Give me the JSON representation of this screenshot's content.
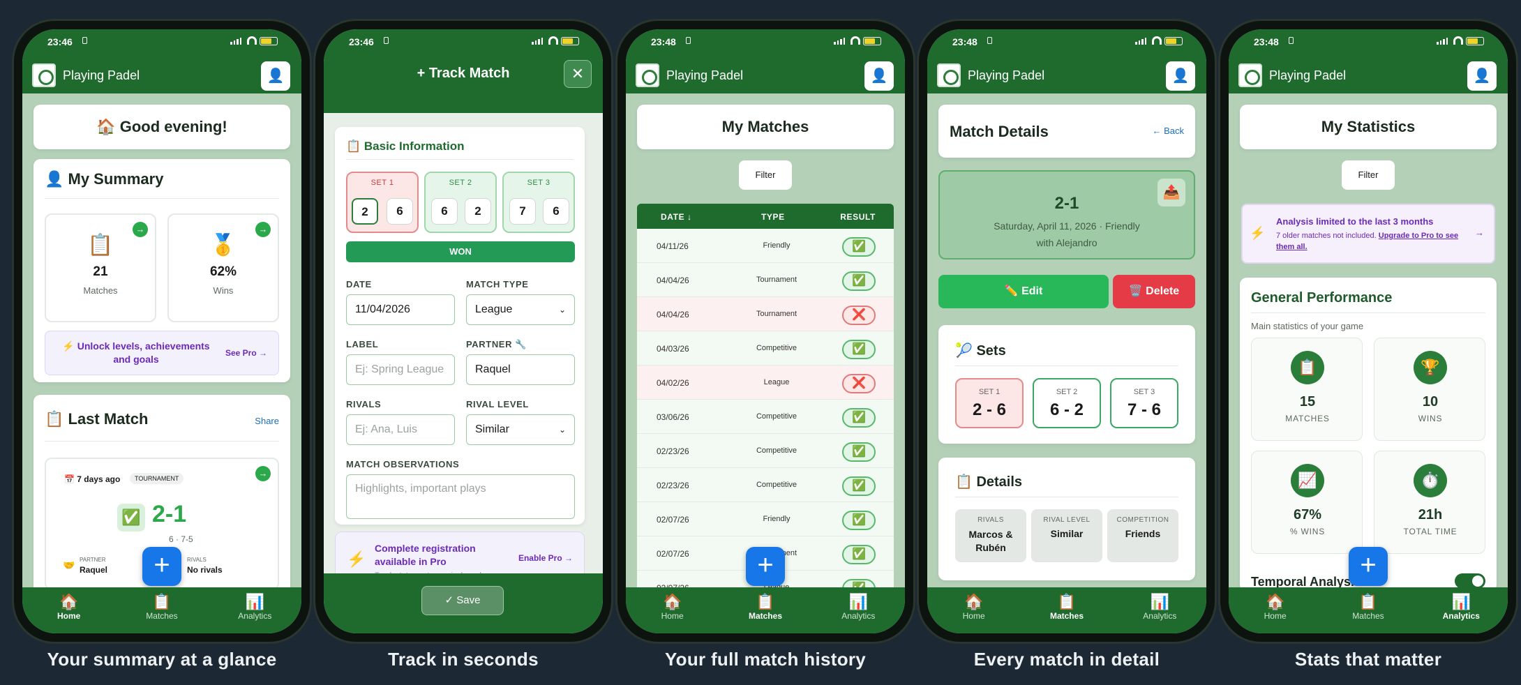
{
  "screens": [
    {
      "time": "23:46",
      "app": "Playing Padel",
      "caption": "Your summary at a glance",
      "greeting": "🏠 Good evening!",
      "summary": {
        "title": "👤 My Summary",
        "matches_value": "21",
        "matches_label": "Matches",
        "wins_value": "62%",
        "wins_label": "Wins",
        "promo": "⚡ Unlock levels, achievements and goals",
        "promo_cta": "See Pro →"
      },
      "last_match": {
        "title": "📋 Last Match",
        "share": "Share",
        "when": "📅 7 days ago",
        "type": "TOURNAMENT",
        "result_icon": "✅",
        "score": "2-1",
        "sets": "6 · 7-5",
        "partner_label": "PARTNER",
        "partner": "Raquel",
        "rivals_label": "RIVALS",
        "rivals": "No rivals"
      }
    },
    {
      "time": "23:46",
      "caption": "Track in seconds",
      "title": "+ Track Match",
      "section": "📋 Basic Information",
      "sets": [
        {
          "label": "SET 1",
          "a": "2",
          "b": "6"
        },
        {
          "label": "SET 2",
          "a": "6",
          "b": "2"
        },
        {
          "label": "SET 3",
          "a": "7",
          "b": "6"
        }
      ],
      "won": "WON",
      "date_label": "DATE",
      "date": "11/04/2026",
      "type_label": "MATCH TYPE",
      "type": "League",
      "label_label": "LABEL",
      "label_ph": "Ej: Spring League",
      "partner_label": "PARTNER 🔧",
      "partner": "Raquel",
      "rivals_label": "RIVALS",
      "rivals_ph": "Ej: Ana, Luis",
      "level_label": "RIVAL LEVEL",
      "level": "Similar",
      "obs_label": "MATCH OBSERVATIONS",
      "obs_ph": "Highlights, important plays",
      "promo": "Complete registration available in Pro",
      "promo_cta": "Enable Pro →",
      "promo_sub": "Track stats, partners, rivals and",
      "save": "✓ Save"
    },
    {
      "time": "23:48",
      "app": "Playing Padel",
      "caption": "Your full match history",
      "title": "My Matches",
      "filter": "Filter",
      "headers": [
        "DATE ↓",
        "TYPE",
        "RESULT"
      ],
      "rows": [
        {
          "date": "04/11/26",
          "type": "Friendly",
          "result": "✅",
          "loss": false
        },
        {
          "date": "04/04/26",
          "type": "Tournament",
          "result": "✅",
          "loss": false
        },
        {
          "date": "04/04/26",
          "type": "Tournament",
          "result": "❌",
          "loss": true
        },
        {
          "date": "04/03/26",
          "type": "Competitive",
          "result": "✅",
          "loss": false
        },
        {
          "date": "04/02/26",
          "type": "League",
          "result": "❌",
          "loss": true
        },
        {
          "date": "03/06/26",
          "type": "Competitive",
          "result": "✅",
          "loss": false
        },
        {
          "date": "02/23/26",
          "type": "Competitive",
          "result": "✅",
          "loss": false
        },
        {
          "date": "02/23/26",
          "type": "Competitive",
          "result": "✅",
          "loss": false
        },
        {
          "date": "02/07/26",
          "type": "Friendly",
          "result": "✅",
          "loss": false
        },
        {
          "date": "02/07/26",
          "type": "Tournament",
          "result": "✅",
          "loss": false
        },
        {
          "date": "02/07/26",
          "type": "League",
          "result": "✅",
          "loss": false
        }
      ]
    },
    {
      "time": "23:48",
      "app": "Playing Padel",
      "caption": "Every match in detail",
      "title": "Match Details",
      "back": "← Back",
      "score": "2-1",
      "date": "Saturday, April 11, 2026 · Friendly",
      "with": "with Alejandro",
      "edit": "✏️ Edit",
      "delete": "🗑️ Delete",
      "sets_title": "🎾 Sets",
      "sets": [
        {
          "label": "SET 1",
          "score": "2 - 6"
        },
        {
          "label": "SET 2",
          "score": "6 - 2"
        },
        {
          "label": "SET 3",
          "score": "7 - 6"
        }
      ],
      "details_title": "📋 Details",
      "details": [
        {
          "k": "RIVALS",
          "v": "Marcos & Rubén"
        },
        {
          "k": "RIVAL LEVEL",
          "v": "Similar"
        },
        {
          "k": "COMPETITION",
          "v": "Friends"
        }
      ]
    },
    {
      "time": "23:48",
      "app": "Playing Padel",
      "caption": "Stats that matter",
      "title": "My Statistics",
      "filter": "Filter",
      "notice": "Analysis limited to the last 3 months",
      "notice_sub": "7 older matches not included.",
      "notice_link": "Upgrade to Pro to see them all.",
      "perf_title": "General Performance",
      "perf_sub": "Main statistics of your game",
      "stats": [
        {
          "icon": "📋",
          "v": "15",
          "k": "MATCHES"
        },
        {
          "icon": "🏆",
          "v": "10",
          "k": "WINS"
        },
        {
          "icon": "📈",
          "v": "67%",
          "k": "% WINS"
        },
        {
          "icon": "⏱️",
          "v": "21h",
          "k": "TOTAL TIME"
        }
      ],
      "temporal": "Temporal Analysis"
    }
  ],
  "tabs": [
    {
      "icon": "🏠",
      "label": "Home"
    },
    {
      "icon": "📋",
      "label": "Matches"
    },
    {
      "icon": "📊",
      "label": "Analytics"
    }
  ],
  "active_tabs": [
    0,
    null,
    1,
    1,
    2
  ]
}
